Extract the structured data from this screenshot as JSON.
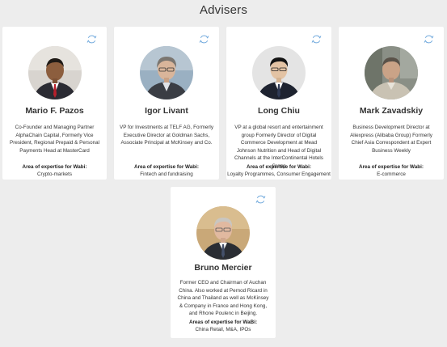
{
  "page": {
    "title": "Advisers",
    "expertise_label_default": "Area of expertise for Wabi:",
    "expertise_label_alt": "Areas of expertise for WaBi:"
  },
  "advisers": [
    {
      "name": "Mario F. Pazos",
      "bio": "Co-Founder and Managing Partner AlphaChain Capital, Formerly Vice President, Regional Prepaid & Personal Payments Head at MasterCard",
      "expertise_label": "Area of expertise for Wabi:",
      "expertise": "Crypto-markets"
    },
    {
      "name": "Igor Livant",
      "bio": "VP for Investments at TELF AG, Formerly Executive Director at Goldman Sachs, Associate Principal at McKinsey and Co.",
      "expertise_label": "Area of expertise for Wabi:",
      "expertise": "Fintech and fundraising"
    },
    {
      "name": "Long Chiu",
      "bio": "VP at a global resort and entertainment group Formerly Director of Digital Commerce Development at Mead Johnson Nutrition and Head of Digital Channels at the InterContinental Hotels Group",
      "expertise_label": "Area of expertise for Wabi:",
      "expertise": "Loyalty Programmes, Consumer Engagement"
    },
    {
      "name": "Mark Zavadskiy",
      "bio": "Business Development Director at Aliexpress (Alibaba Group) Formerly Chief Asia Correspondent at Expert Business Weekly",
      "expertise_label": "Area of expertise for Wabi:",
      "expertise": "E-commerce"
    },
    {
      "name": "Bruno Mercier",
      "bio": "Former CEO and Chairman of Auchan China. Also worked at Pernod Ricard in China and Thailand as well as McKinsey & Company in France and Hong Kong, and Rhone Poulenc in Beijing.",
      "expertise_label": "Areas of expertise for WaBi:",
      "expertise": "China Retail, M&A, IPOs"
    }
  ],
  "colors": {
    "background": "#ededed",
    "card": "#ffffff",
    "flip_icon": "#6fa8dc"
  },
  "icons": {
    "flip": "refresh-icon"
  }
}
